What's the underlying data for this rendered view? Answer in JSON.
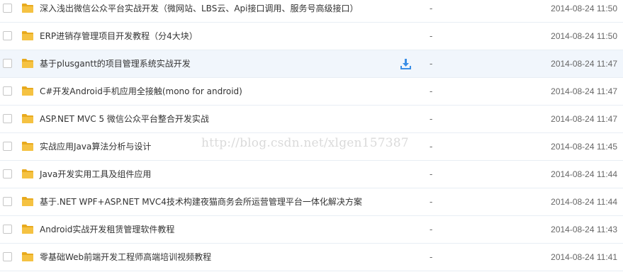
{
  "files": [
    {
      "name": "深入浅出微信公众平台实战开发（微网站、LBS云、Api接口调用、服务号高级接口）",
      "size": "-",
      "date": "2014-08-24 11:50",
      "hover": false
    },
    {
      "name": "ERP进销存管理项目开发教程（分4大块）",
      "size": "-",
      "date": "2014-08-24 11:50",
      "hover": false
    },
    {
      "name": "基于plusgantt的项目管理系统实战开发",
      "size": "-",
      "date": "2014-08-24 11:47",
      "hover": true
    },
    {
      "name": "C#开发Android手机应用全接触(mono for android)",
      "size": "-",
      "date": "2014-08-24 11:47",
      "hover": false
    },
    {
      "name": "ASP.NET MVC 5 微信公众平台整合开发实战",
      "size": "-",
      "date": "2014-08-24 11:47",
      "hover": false
    },
    {
      "name": "实战应用Java算法分析与设计",
      "size": "-",
      "date": "2014-08-24 11:45",
      "hover": false
    },
    {
      "name": "Java开发实用工具及组件应用",
      "size": "-",
      "date": "2014-08-24 11:44",
      "hover": false
    },
    {
      "name": "基于.NET WPF+ASP.NET MVC4技术构建夜猫商务会所运营管理平台一体化解决方案",
      "size": "-",
      "date": "2014-08-24 11:44",
      "hover": false
    },
    {
      "name": "Android实战开发租赁管理软件教程",
      "size": "-",
      "date": "2014-08-24 11:43",
      "hover": false
    },
    {
      "name": "零基础Web前端开发工程师高端培训视频教程",
      "size": "-",
      "date": "2014-08-24 11:41",
      "hover": false
    }
  ],
  "icons": {
    "folder": "folder-icon",
    "download": "download-icon",
    "checkbox": "checkbox"
  },
  "colors": {
    "folder": "#f5c242",
    "download": "#3a8ee6",
    "hover_row": "#f1f6fc"
  },
  "watermark": "http://blog.csdn.net/xlgen157387"
}
